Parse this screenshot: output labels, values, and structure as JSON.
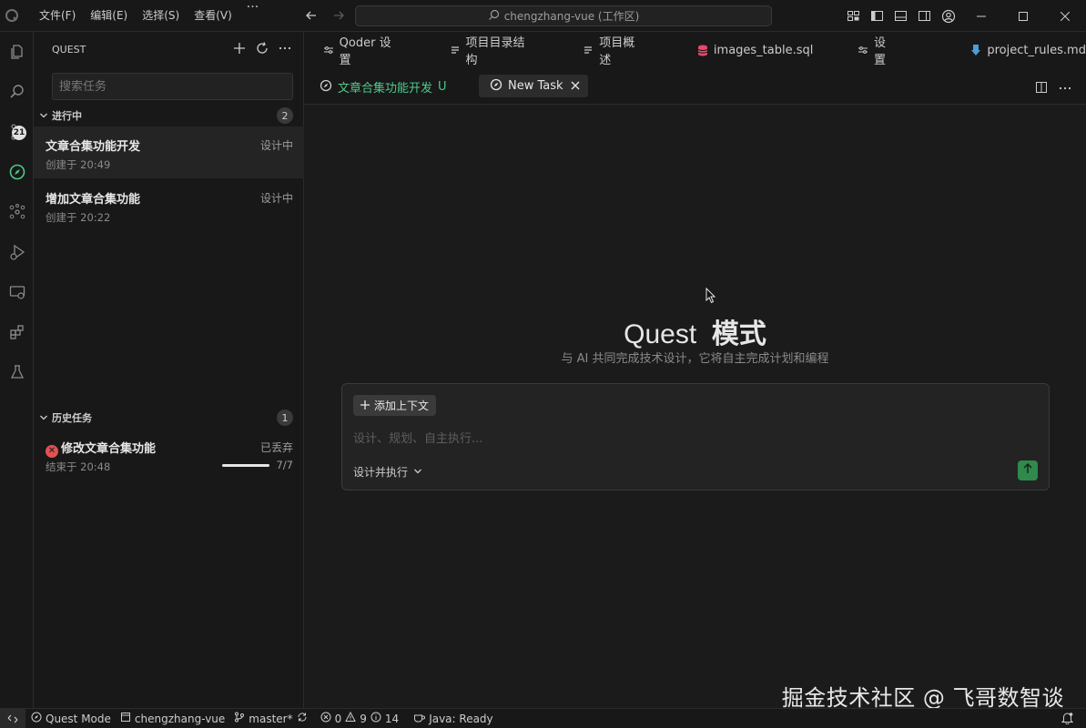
{
  "titlebar": {
    "menus": [
      "文件(F)",
      "编辑(E)",
      "选择(S)",
      "查看(V)"
    ],
    "more": "···",
    "search_text": "chengzhang-vue (工作区)"
  },
  "sidebar": {
    "header": "QUEST",
    "search_placeholder": "搜索任务",
    "in_progress": {
      "title": "进行中",
      "count": "2",
      "tasks": [
        {
          "title": "文章合集功能开发",
          "status": "设计中",
          "meta": "创建于 20:49"
        },
        {
          "title": "增加文章合集功能",
          "status": "设计中",
          "meta": "创建于 20:22"
        }
      ]
    },
    "history": {
      "title": "历史任务",
      "count": "1",
      "tasks": [
        {
          "title": "修改文章合集功能",
          "status": "已丢弃",
          "meta": "结束于 20:48",
          "progress_text": "7/7",
          "progress_fraction": 1.0
        }
      ]
    }
  },
  "activity_badge": "21",
  "tabs_row1": [
    "Qoder 设置",
    "项目目录结构",
    "项目概述",
    "images_table.sql",
    "设置",
    "project_rules.md"
  ],
  "tabs_row2": {
    "tab1": {
      "label": "文章合集功能开发",
      "modifier": "U"
    },
    "tab2": {
      "label": "New Task"
    }
  },
  "main": {
    "hero_word": "Quest",
    "hero_bold": "模式",
    "subtitle": "与 AI 共同完成技术设计，它将自主完成计划和编程",
    "add_context": "添加上下文",
    "input_placeholder": "设计、规划、自主执行...",
    "mode_label": "设计并执行"
  },
  "watermark": "掘金技术社区 @ 飞哥数智谈",
  "statusbar": {
    "mode": "Quest Mode",
    "project": "chengzhang-vue",
    "branch": "master*",
    "errors": "0",
    "warnings": "9",
    "infos": "14",
    "java": "Java: Ready"
  },
  "colors": {
    "accent_green": "#4ec98a",
    "send_green": "#2f8a4b",
    "error_red": "#e05252"
  }
}
